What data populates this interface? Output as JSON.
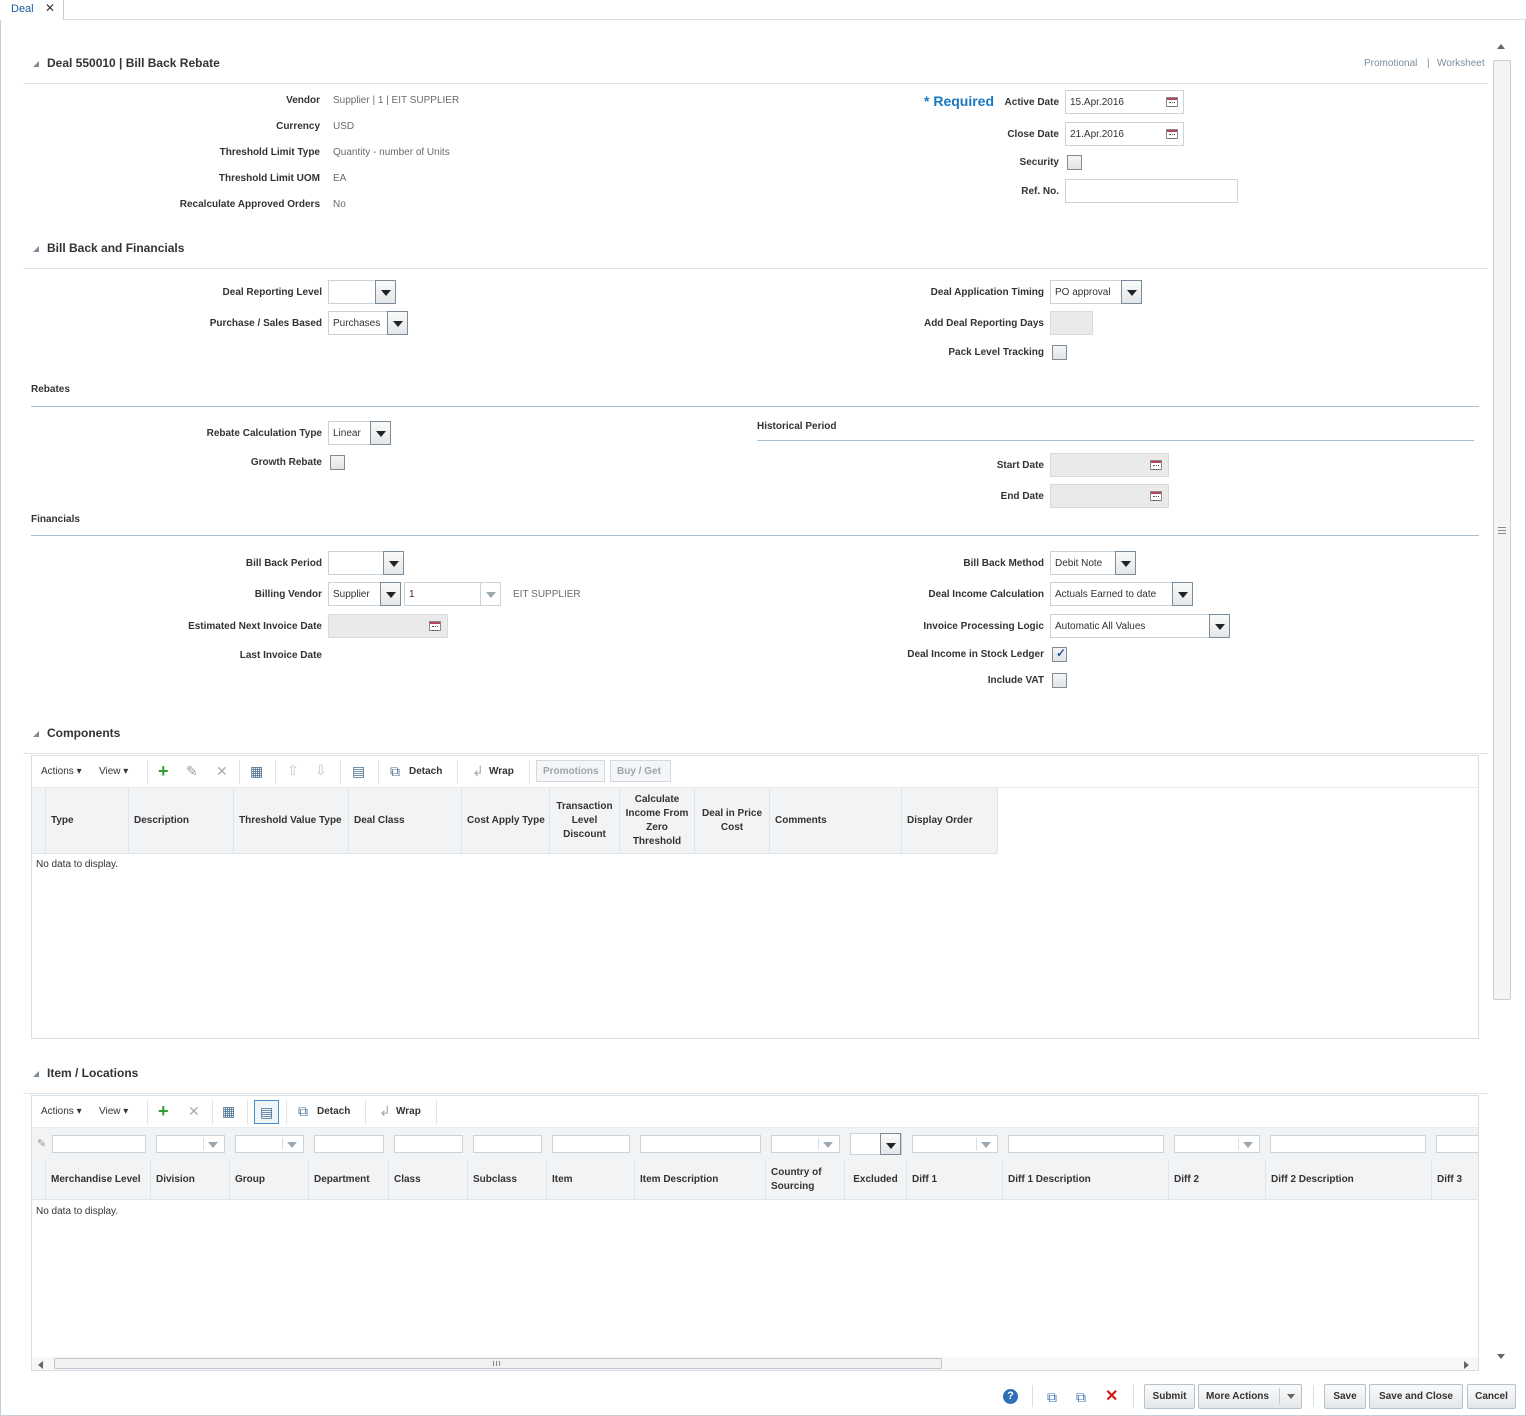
{
  "tab": {
    "label": "Deal",
    "close": "✕"
  },
  "header": {
    "title": "Deal 550010  |  Bill Back Rebate",
    "links": [
      "Promotional",
      "|",
      "Worksheet"
    ]
  },
  "deal_info": {
    "vendor_label": "Vendor",
    "vendor_value": "Supplier  |  1  |  EIT SUPPLIER",
    "currency_label": "Currency",
    "currency_value": "USD",
    "threshold_type_label": "Threshold Limit Type",
    "threshold_type_value": "Quantity - number of Units",
    "threshold_uom_label": "Threshold Limit UOM",
    "threshold_uom_value": "EA",
    "recalc_label": "Recalculate Approved Orders",
    "recalc_value": "No",
    "required": "* Required",
    "active_date_label": "Active Date",
    "active_date_value": "15.Apr.2016",
    "close_date_label": "Close Date",
    "close_date_value": "21.Apr.2016",
    "security_label": "Security",
    "ref_no_label": "Ref. No.",
    "ref_no_value": ""
  },
  "bill_back": {
    "title": "Bill Back and Financials",
    "reporting_level_label": "Deal Reporting Level",
    "reporting_level_value": "",
    "purchase_sales_label": "Purchase / Sales Based",
    "purchase_sales_value": "Purchases",
    "app_timing_label": "Deal Application Timing",
    "app_timing_value": "PO approval",
    "add_days_label": "Add Deal Reporting Days",
    "add_days_value": "",
    "pack_tracking_label": "Pack Level Tracking"
  },
  "rebates": {
    "title": "Rebates",
    "calc_type_label": "Rebate Calculation Type",
    "calc_type_value": "Linear",
    "growth_label": "Growth Rebate",
    "historical_title": "Historical Period",
    "start_date_label": "Start Date",
    "end_date_label": "End Date"
  },
  "financials": {
    "title": "Financials",
    "period_label": "Bill Back Period",
    "period_value": "",
    "billing_vendor_label": "Billing Vendor",
    "billing_vendor_type": "Supplier",
    "billing_vendor_id": "1",
    "billing_vendor_name": "EIT SUPPLIER",
    "next_invoice_label": "Estimated Next Invoice Date",
    "last_invoice_label": "Last Invoice Date",
    "method_label": "Bill Back Method",
    "method_value": "Debit Note",
    "income_calc_label": "Deal Income Calculation",
    "income_calc_value": "Actuals Earned to date",
    "invoice_logic_label": "Invoice Processing Logic",
    "invoice_logic_value": "Automatic All Values",
    "stock_ledger_label": "Deal Income in Stock Ledger",
    "stock_ledger_checked": true,
    "vat_label": "Include VAT"
  },
  "components": {
    "title": "Components",
    "toolbar": {
      "actions": "Actions ▾",
      "view": "View ▾",
      "detach": "Detach",
      "wrap": "Wrap",
      "promotions": "Promotions",
      "buy_get": "Buy / Get"
    },
    "columns": [
      "Type",
      "Description",
      "Threshold Value Type",
      "Deal Class",
      "Cost Apply Type",
      "Transaction Level Discount",
      "Calculate Income From Zero Threshold",
      "Deal in Price Cost",
      "Comments",
      "Display Order"
    ],
    "empty": "No data to display."
  },
  "items": {
    "title": "Item / Locations",
    "toolbar": {
      "actions": "Actions ▾",
      "view": "View ▾",
      "detach": "Detach",
      "wrap": "Wrap"
    },
    "columns": [
      "Merchandise Level",
      "Division",
      "Group",
      "Department",
      "Class",
      "Subclass",
      "Item",
      "Item Description",
      "Country of Sourcing",
      "Excluded",
      "Diff 1",
      "Diff 1 Description",
      "Diff 2",
      "Diff 2 Description",
      "Diff 3"
    ],
    "empty": "No data to display."
  },
  "footer": {
    "submit": "Submit",
    "more_actions": "More Actions",
    "save": "Save",
    "save_close": "Save and Close",
    "cancel": "Cancel"
  }
}
